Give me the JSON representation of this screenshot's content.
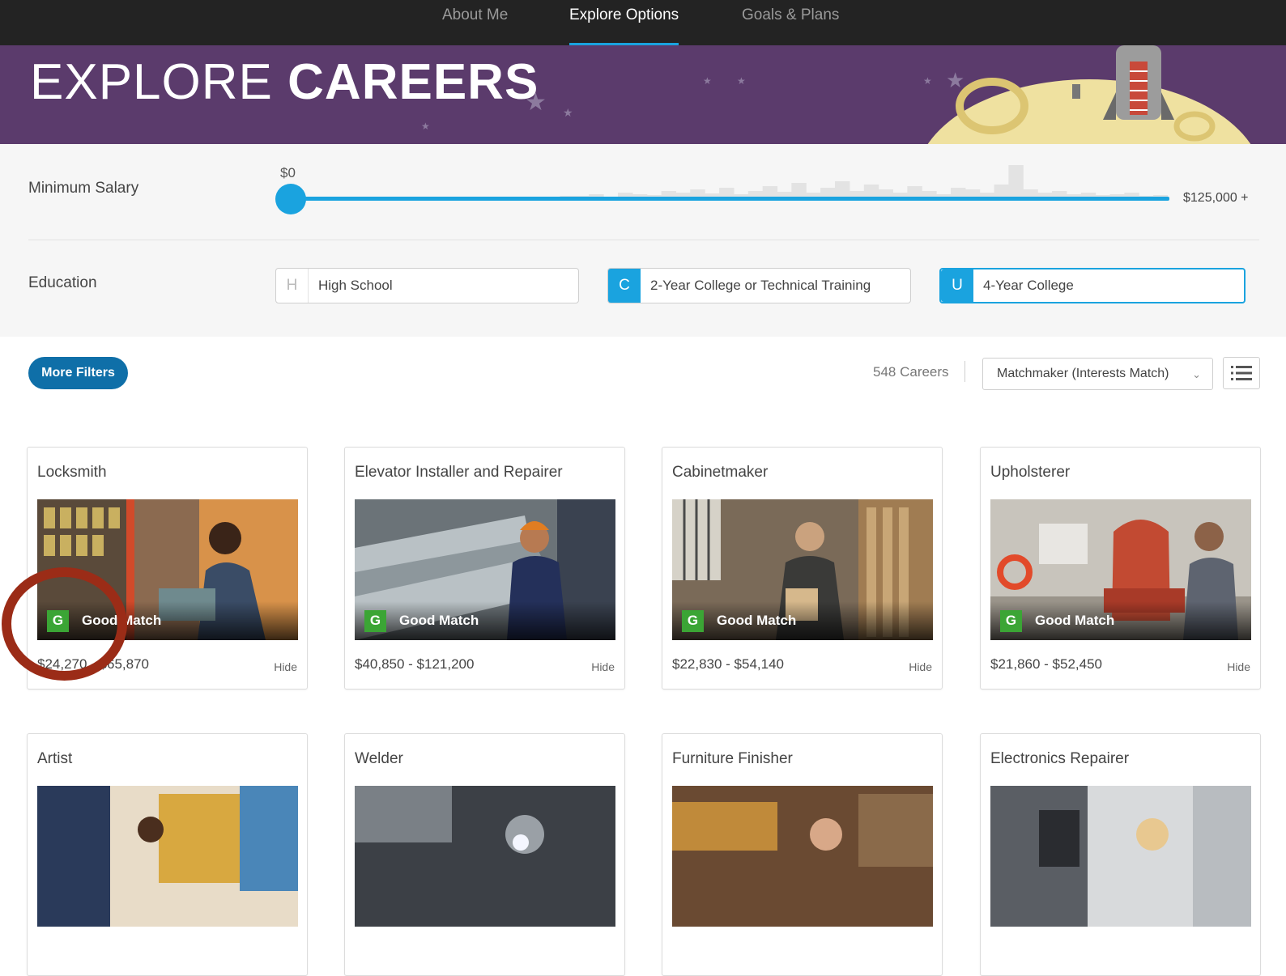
{
  "nav": {
    "tabs": [
      {
        "label": "About Me"
      },
      {
        "label": "Explore Options"
      },
      {
        "label": "Goals & Plans"
      }
    ],
    "active_tab": "Explore Options"
  },
  "banner": {
    "title_light": "EXPLORE",
    "title_bold": "CAREERS"
  },
  "filters": {
    "salary": {
      "label": "Minimum Salary",
      "current_value": "$0",
      "max_label": "$125,000 +",
      "slider_fraction": 0.0
    },
    "education": {
      "label": "Education",
      "options": [
        {
          "letter": "H",
          "label": "High School",
          "selected": false
        },
        {
          "letter": "C",
          "label": "2-Year College or Technical Training",
          "selected": true
        },
        {
          "letter": "U",
          "label": "4-Year College",
          "selected": true
        }
      ]
    }
  },
  "toolbar": {
    "more_filters_label": "More Filters",
    "count_label": "548 Careers",
    "sort_value": "Matchmaker (Interests Match)"
  },
  "colors": {
    "accent": "#1aa3df",
    "banner": "#5b3b6c",
    "match_badge": "#3ba535",
    "annotation": "#9b2c17"
  },
  "cards": [
    {
      "title": "Locksmith",
      "match_letter": "G",
      "match_label": "Good Match",
      "salary": "$24,270 - $65,870",
      "hide_label": "Hide"
    },
    {
      "title": "Elevator Installer and Repairer",
      "match_letter": "G",
      "match_label": "Good Match",
      "salary": "$40,850 - $121,200",
      "hide_label": "Hide"
    },
    {
      "title": "Cabinetmaker",
      "match_letter": "G",
      "match_label": "Good Match",
      "salary": "$22,830 - $54,140",
      "hide_label": "Hide"
    },
    {
      "title": "Upholsterer",
      "match_letter": "G",
      "match_label": "Good Match",
      "salary": "$21,860 - $52,450",
      "hide_label": "Hide"
    },
    {
      "title": "Artist"
    },
    {
      "title": "Welder"
    },
    {
      "title": "Furniture Finisher"
    },
    {
      "title": "Electronics Repairer"
    }
  ]
}
